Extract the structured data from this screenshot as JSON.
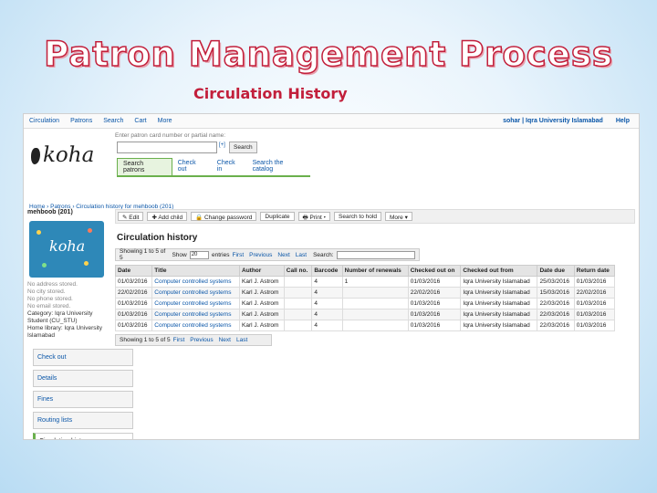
{
  "slide": {
    "title": "Patron Management Process",
    "subtitle": "Circulation History"
  },
  "topnav": {
    "items": [
      "Circulation",
      "Patrons",
      "Search",
      "Cart",
      "More"
    ],
    "user": "sohar | Iqra University Islamabad",
    "help": "Help"
  },
  "header": {
    "logo": "koha",
    "search_hint": "Enter patron card number or partial name:",
    "plus_label": "[+]",
    "search_button": "Search",
    "tabs": [
      "Search patrons",
      "Check out",
      "Check in",
      "Search the catalog"
    ]
  },
  "breadcrumb": "Home › Patrons › Circulation history for mehboob (201)",
  "patron": {
    "name": "mehboob (201)",
    "image_word": "koha",
    "no_address": "No address stored.",
    "no_city": "No city stored.",
    "no_phone": "No phone stored.",
    "no_email": "No email stored.",
    "category": "Category: Iqra University",
    "category2": "Student (CU_STU)",
    "library": "Home library: Iqra University",
    "library2": "Islamabad"
  },
  "side_menu": [
    "Check out",
    "Details",
    "Fines",
    "Routing lists",
    "Circulation history"
  ],
  "toolbar": [
    "✎ Edit",
    "✚ Add child",
    "🔒 Change password",
    "Duplicate",
    "🖶 Print ▾",
    "Search to hold",
    "More ▾"
  ],
  "page_heading": "Circulation history",
  "table_controls": {
    "showing": "Showing 1 to 5 of 5",
    "show": "Show",
    "page_size": "20",
    "entries": "entries",
    "first": "First",
    "previous": "Previous",
    "next": "Next",
    "last": "Last",
    "search": "Search:"
  },
  "table": {
    "headers": [
      "Date",
      "Title",
      "Author",
      "Call no.",
      "Barcode",
      "Number of renewals",
      "Checked out on",
      "Checked out from",
      "Date due",
      "Return date"
    ],
    "rows": [
      [
        "01/03/2016",
        "Computer controlled systems",
        "Karl J. Astrom",
        "",
        "4",
        "1",
        "01/03/2016",
        "Iqra University Islamabad",
        "25/03/2016",
        "01/03/2016"
      ],
      [
        "22/02/2016",
        "Computer controlled systems",
        "Karl J. Astrom",
        "",
        "4",
        "",
        "22/02/2016",
        "Iqra University Islamabad",
        "15/03/2016",
        "22/02/2016"
      ],
      [
        "01/03/2016",
        "Computer controlled systems",
        "Karl J. Astrom",
        "",
        "4",
        "",
        "01/03/2016",
        "Iqra University Islamabad",
        "22/03/2016",
        "01/03/2016"
      ],
      [
        "01/03/2016",
        "Computer controlled systems",
        "Karl J. Astrom",
        "",
        "4",
        "",
        "01/03/2016",
        "Iqra University Islamabad",
        "22/03/2016",
        "01/03/2016"
      ],
      [
        "01/03/2016",
        "Computer controlled systems",
        "Karl J. Astrom",
        "",
        "4",
        "",
        "01/03/2016",
        "Iqra University Islamabad",
        "22/03/2016",
        "01/03/2016"
      ]
    ]
  },
  "bottom_controls": {
    "showing": "Showing 1 to 5 of 5",
    "first": "First",
    "previous": "Previous",
    "next": "Next",
    "last": "Last"
  }
}
